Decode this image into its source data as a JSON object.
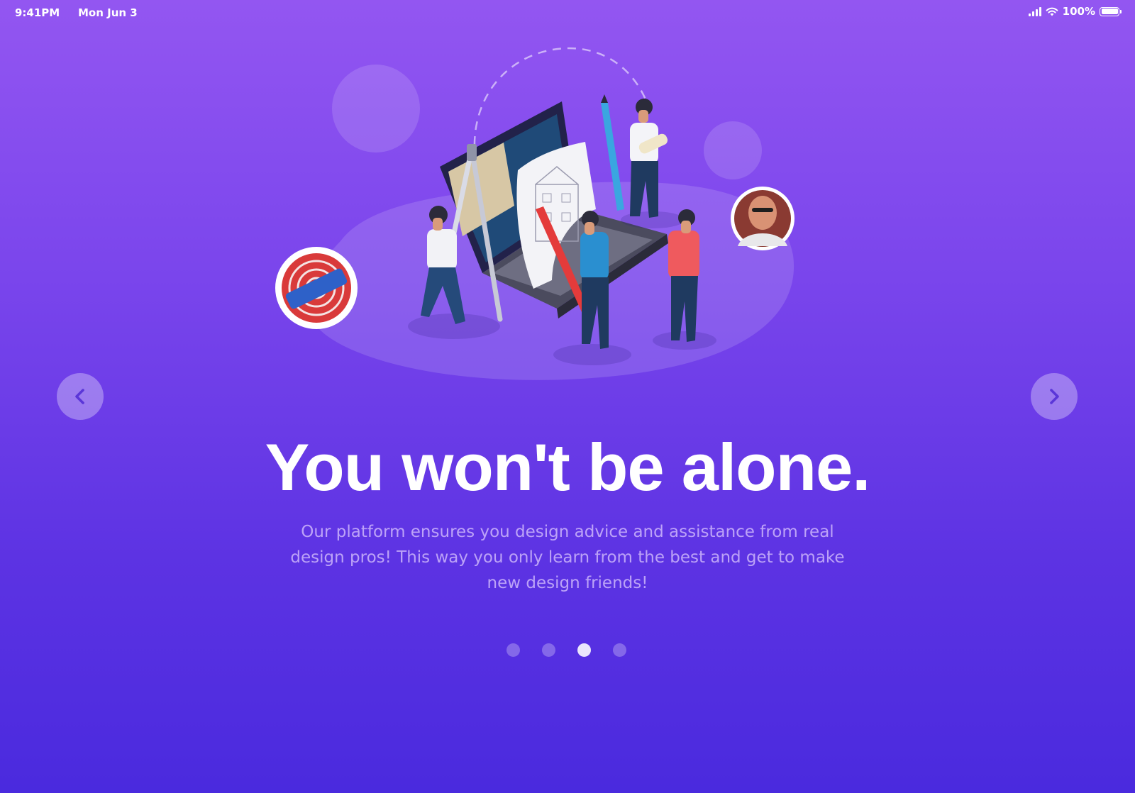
{
  "status_bar": {
    "time": "9:41PM",
    "date": "Mon Jun 3",
    "battery_percent": "100%",
    "icons": [
      "signal-icon",
      "wifi-icon",
      "battery-icon"
    ]
  },
  "onboarding": {
    "title": "You won't be alone.",
    "description": "Our platform ensures you design advice and assistance from real design pros! This way you only learn from the best and get to make new design friends!",
    "prev_icon": "chevron-left-icon",
    "next_icon": "chevron-right-icon",
    "pagination": {
      "total": 4,
      "current": 3
    }
  },
  "colors": {
    "background_top": "#9356f1",
    "background_bottom": "#4a2ade",
    "text_primary": "#ffffff"
  }
}
